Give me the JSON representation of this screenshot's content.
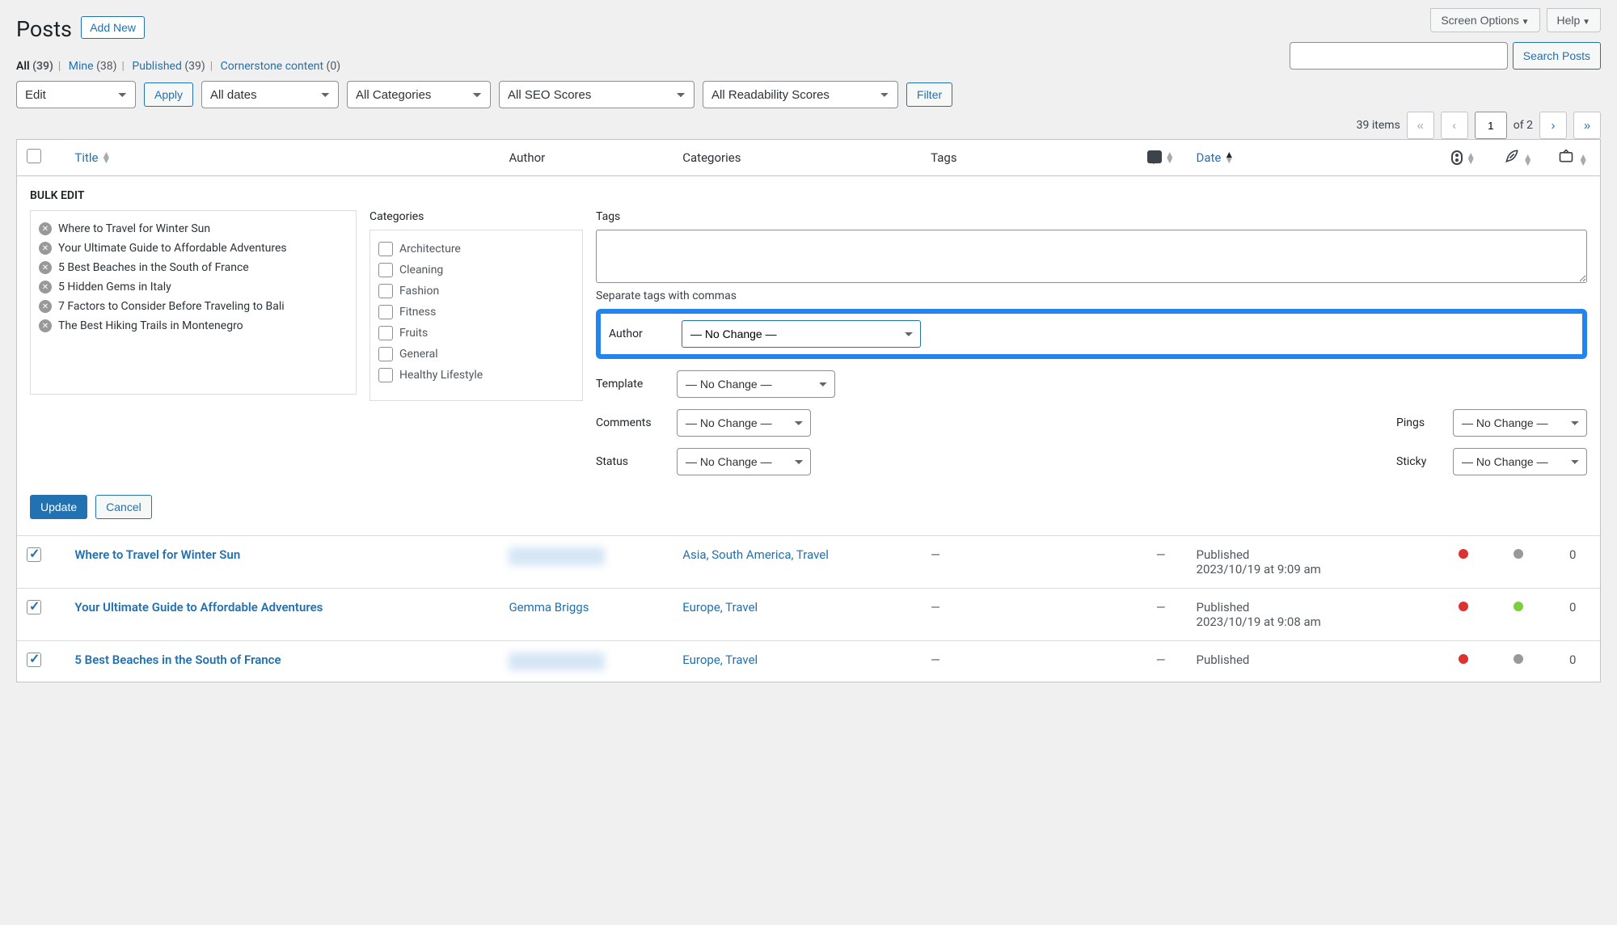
{
  "topButtons": {
    "screenOptions": "Screen Options",
    "help": "Help"
  },
  "page": {
    "title": "Posts",
    "addNew": "Add New"
  },
  "views": {
    "all": {
      "label": "All",
      "count": "(39)"
    },
    "mine": {
      "label": "Mine",
      "count": "(38)"
    },
    "published": {
      "label": "Published",
      "count": "(39)"
    },
    "cornerstone": {
      "label": "Cornerstone content",
      "count": "(0)"
    }
  },
  "search": {
    "button": "Search Posts"
  },
  "actions": {
    "bulk": "Edit",
    "apply": "Apply",
    "dates": "All dates",
    "categories": "All Categories",
    "seo": "All SEO Scores",
    "readability": "All Readability Scores",
    "filter": "Filter"
  },
  "pagination": {
    "items": "39 items",
    "current": "1",
    "totalText": "of 2"
  },
  "columns": {
    "title": "Title",
    "author": "Author",
    "categories": "Categories",
    "tags": "Tags",
    "date": "Date"
  },
  "bulkEdit": {
    "legend": "BULK EDIT",
    "items": [
      "Where to Travel for Winter Sun",
      "Your Ultimate Guide to Affordable Adventures",
      "5 Best Beaches in the South of France",
      "5 Hidden Gems in Italy",
      "7 Factors to Consider Before Traveling to Bali",
      "The Best Hiking Trails in Montenegro"
    ],
    "categoriesLabel": "Categories",
    "categoryList": [
      "Architecture",
      "Cleaning",
      "Fashion",
      "Fitness",
      "Fruits",
      "General",
      "Healthy Lifestyle"
    ],
    "tagsLabel": "Tags",
    "tagsHint": "Separate tags with commas",
    "noChange": "— No Change —",
    "labels": {
      "author": "Author",
      "template": "Template",
      "comments": "Comments",
      "pings": "Pings",
      "status": "Status",
      "sticky": "Sticky"
    },
    "update": "Update",
    "cancel": "Cancel"
  },
  "rows": [
    {
      "title": "Where to Travel for Winter Sun",
      "authorBlur": true,
      "author": "hollysantamera",
      "categories": "Asia, South America, Travel",
      "tags": "—",
      "comments": "—",
      "status": "Published",
      "dateline": "2023/10/19 at 9:09 am",
      "seoDot": "red",
      "readDot": "gray",
      "links": "0"
    },
    {
      "title": "Your Ultimate Guide to Affordable Adventures",
      "authorBlur": false,
      "author": "Gemma Briggs",
      "categories": "Europe, Travel",
      "tags": "—",
      "comments": "—",
      "status": "Published",
      "dateline": "2023/10/19 at 9:08 am",
      "seoDot": "red",
      "readDot": "green",
      "links": "0"
    },
    {
      "title": "5 Best Beaches in the South of France",
      "authorBlur": true,
      "author": "hollysantamera",
      "categories": "Europe, Travel",
      "tags": "—",
      "comments": "—",
      "status": "Published",
      "dateline": "",
      "seoDot": "red",
      "readDot": "gray",
      "links": "0"
    }
  ]
}
